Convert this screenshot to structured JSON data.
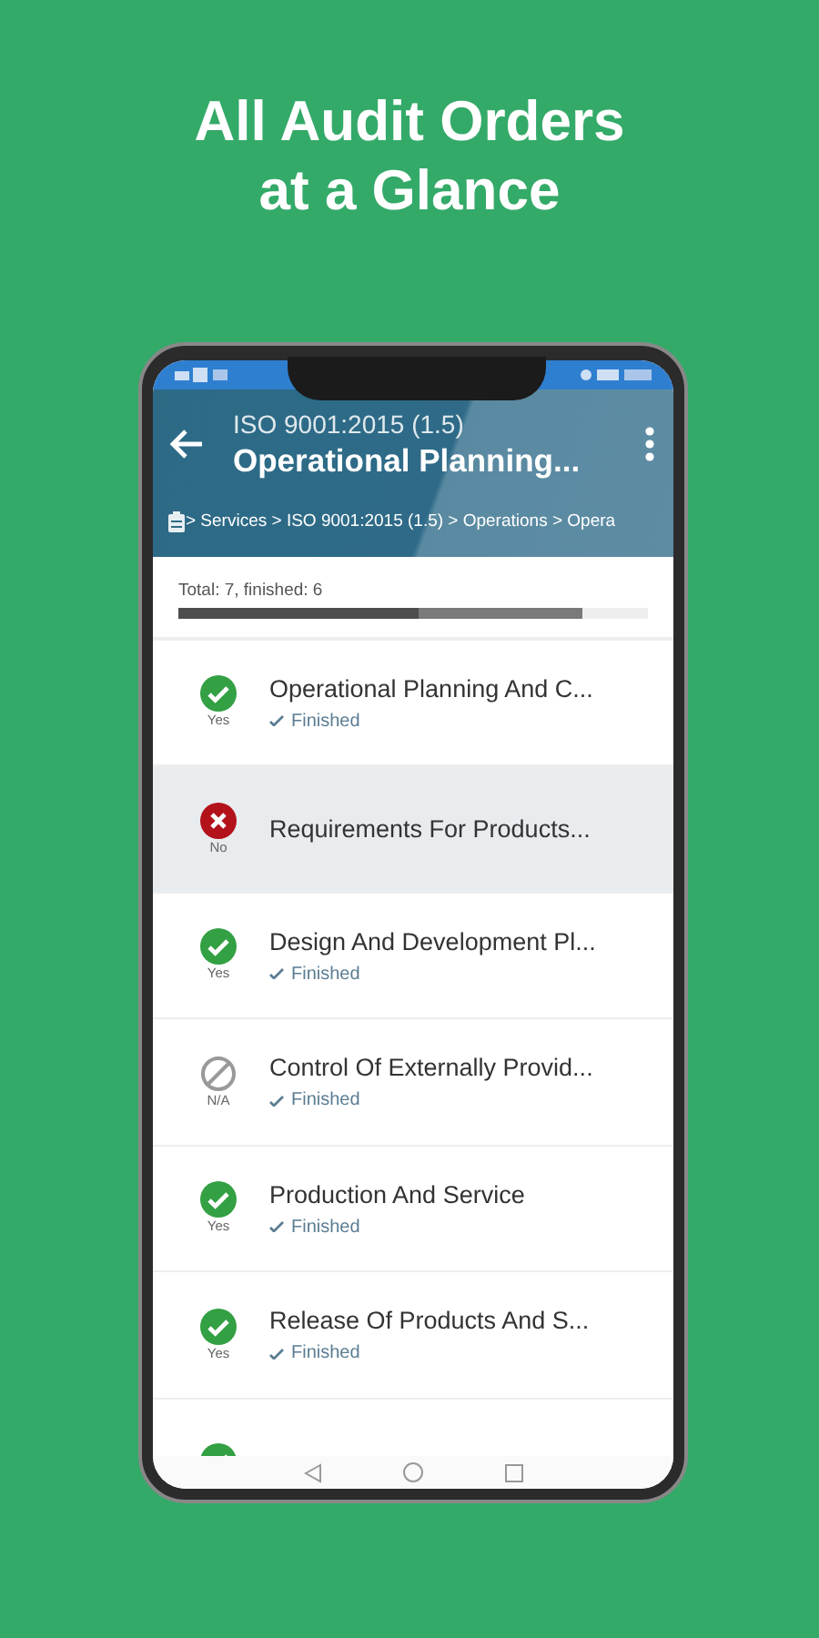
{
  "headline": [
    "All Audit Orders",
    "at a Glance"
  ],
  "app_bar": {
    "subtitle": "ISO 9001:2015 (1.5)",
    "title": "Operational Planning...",
    "breadcrumb": " > Services > ISO 9001:2015 (1.5) > Operations > Opera"
  },
  "progress": {
    "label": "Total: 7, finished: 6",
    "layers": [
      {
        "kind": "finished",
        "level": 0.86
      },
      {
        "kind": "answered",
        "level": 0.51
      }
    ]
  },
  "rows": [
    {
      "kind": "yes",
      "answer": "Yes",
      "title": "Operational Planning And C...",
      "status": "Finished",
      "selected": false
    },
    {
      "kind": "no",
      "answer": "No",
      "title": "Requirements For Products...",
      "selected": true
    },
    {
      "kind": "yes",
      "answer": "Yes",
      "title": "Design And Development Pl...",
      "status": "Finished",
      "selected": false
    },
    {
      "kind": "na",
      "answer": "N/A",
      "title": "Control Of Externally Provid...",
      "status": "Finished",
      "selected": false
    },
    {
      "kind": "yes",
      "answer": "Yes",
      "title": "Production And Service",
      "status": "Finished",
      "selected": false
    },
    {
      "kind": "yes",
      "answer": "Yes",
      "title": "Release Of Products And S...",
      "status": "Finished",
      "selected": false
    },
    {
      "kind": "yes",
      "selected": false
    }
  ]
}
